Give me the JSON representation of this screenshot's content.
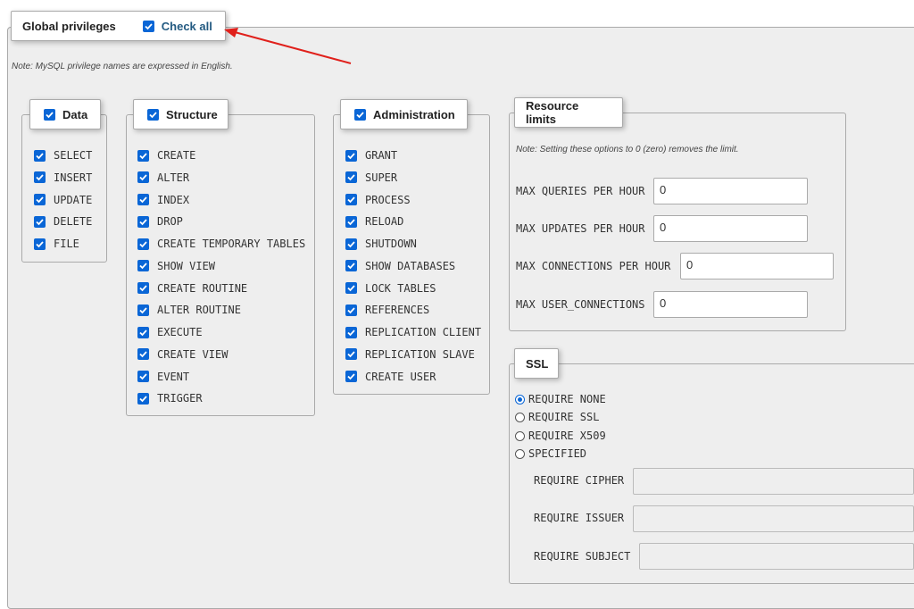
{
  "header": {
    "title": "Global privileges",
    "check_all_label": "Check all",
    "note": "Note: MySQL privilege names are expressed in English."
  },
  "groups": {
    "data": {
      "title": "Data",
      "items": [
        "SELECT",
        "INSERT",
        "UPDATE",
        "DELETE",
        "FILE"
      ]
    },
    "structure": {
      "title": "Structure",
      "items": [
        "CREATE",
        "ALTER",
        "INDEX",
        "DROP",
        "CREATE TEMPORARY TABLES",
        "SHOW VIEW",
        "CREATE ROUTINE",
        "ALTER ROUTINE",
        "EXECUTE",
        "CREATE VIEW",
        "EVENT",
        "TRIGGER"
      ]
    },
    "administration": {
      "title": "Administration",
      "items": [
        "GRANT",
        "SUPER",
        "PROCESS",
        "RELOAD",
        "SHUTDOWN",
        "SHOW DATABASES",
        "LOCK TABLES",
        "REFERENCES",
        "REPLICATION CLIENT",
        "REPLICATION SLAVE",
        "CREATE USER"
      ]
    }
  },
  "resource_limits": {
    "title": "Resource limits",
    "note": "Note: Setting these options to 0 (zero) removes the limit.",
    "fields": [
      {
        "label": "MAX QUERIES PER HOUR",
        "value": "0"
      },
      {
        "label": "MAX UPDATES PER HOUR",
        "value": "0"
      },
      {
        "label": "MAX CONNECTIONS PER HOUR",
        "value": "0"
      },
      {
        "label": "MAX USER_CONNECTIONS",
        "value": "0"
      }
    ]
  },
  "ssl": {
    "title": "SSL",
    "options": [
      "REQUIRE NONE",
      "REQUIRE SSL",
      "REQUIRE X509",
      "SPECIFIED"
    ],
    "selected": "REQUIRE NONE",
    "fields": [
      {
        "label": "REQUIRE CIPHER",
        "value": ""
      },
      {
        "label": "REQUIRE ISSUER",
        "value": ""
      },
      {
        "label": "REQUIRE SUBJECT",
        "value": ""
      }
    ]
  },
  "colors": {
    "checkbox": "#0a66d6",
    "arrow": "#e0201b",
    "link": "#235a81"
  },
  "icons": {
    "checkbox": "checkmark-icon",
    "annotation": "red-arrow-icon"
  }
}
